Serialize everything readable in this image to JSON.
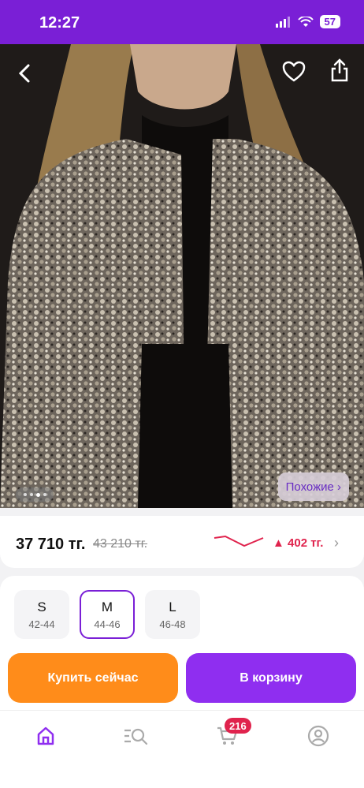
{
  "status_bar": {
    "time": "12:27",
    "battery": "57"
  },
  "photo": {
    "similar_label": "Похожие ›"
  },
  "price": {
    "current": "37 710 тг.",
    "old": "43 210 тг.",
    "change": "▲ 402 тг."
  },
  "sizes": [
    {
      "letter": "S",
      "range": "42-44",
      "selected": false
    },
    {
      "letter": "M",
      "range": "44-46",
      "selected": true
    },
    {
      "letter": "L",
      "range": "46-48",
      "selected": false
    }
  ],
  "actions": {
    "buy_now": "Купить сейчас",
    "add_to_cart": "В корзину"
  },
  "tabbar": {
    "cart_badge": "216"
  },
  "colors": {
    "accent": "#8f2ef0",
    "status_bar": "#7a1fd6",
    "buy": "#ff8c1a",
    "price_change": "#e0234d"
  },
  "icons": [
    "back-arrow-icon",
    "heart-icon",
    "share-icon",
    "home-icon",
    "catalog-search-icon",
    "cart-icon",
    "profile-icon",
    "wifi-icon",
    "signal-icon"
  ]
}
